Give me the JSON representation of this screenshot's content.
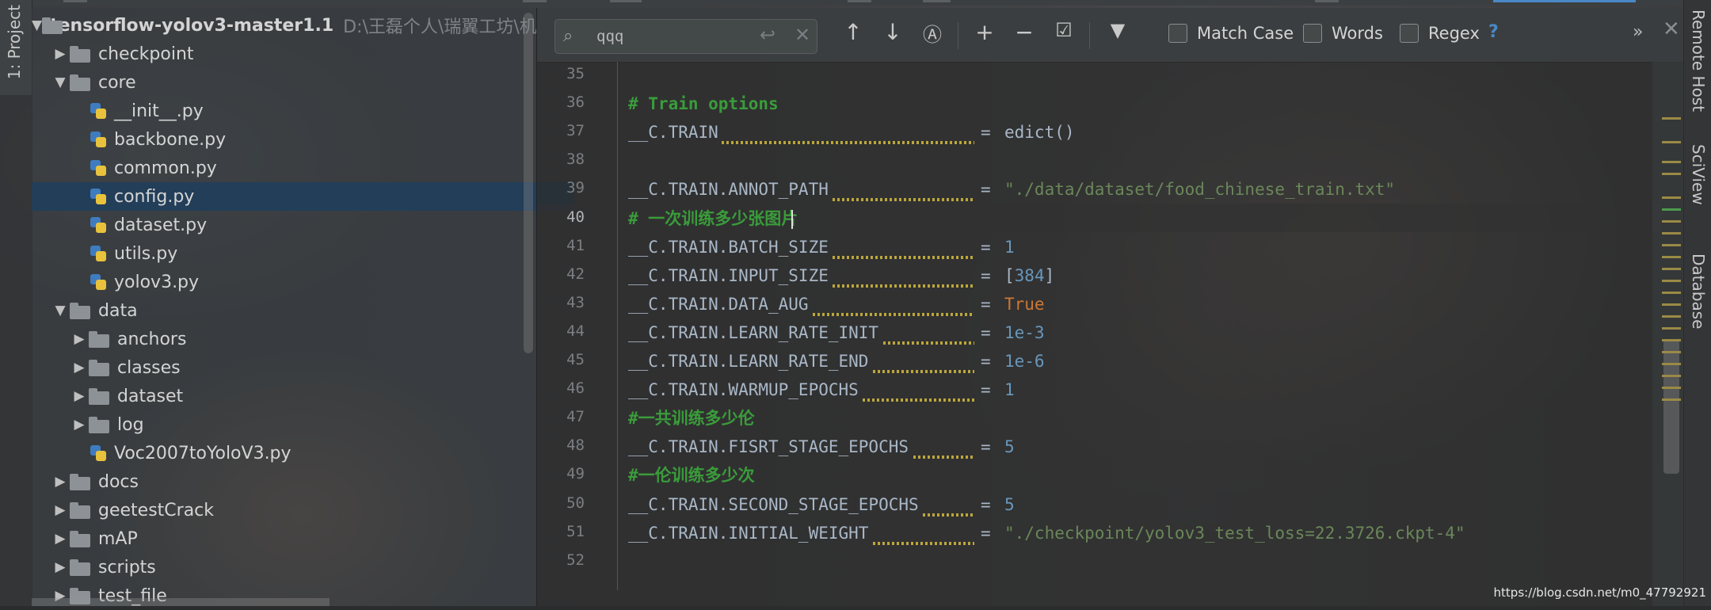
{
  "left_strip": {
    "project_tab": "1: Project"
  },
  "right_strip": {
    "remote_host": "Remote Host",
    "sciview": "SciView",
    "database": "Database"
  },
  "tree": {
    "root": {
      "name": "tensorflow-yolov3-master1.1",
      "path": "D:\\王磊个人\\瑞翼工坊\\机"
    },
    "rows": [
      {
        "name": "checkpoint",
        "type": "folder",
        "level": 1,
        "expanded": false
      },
      {
        "name": "core",
        "type": "folder",
        "level": 1,
        "expanded": true
      },
      {
        "name": "__init__.py",
        "type": "file",
        "level": 2
      },
      {
        "name": "backbone.py",
        "type": "file",
        "level": 2
      },
      {
        "name": "common.py",
        "type": "file",
        "level": 2
      },
      {
        "name": "config.py",
        "type": "file",
        "level": 2,
        "selected": true
      },
      {
        "name": "dataset.py",
        "type": "file",
        "level": 2
      },
      {
        "name": "utils.py",
        "type": "file",
        "level": 2
      },
      {
        "name": "yolov3.py",
        "type": "file",
        "level": 2
      },
      {
        "name": "data",
        "type": "folder",
        "level": 1,
        "expanded": true
      },
      {
        "name": "anchors",
        "type": "folder",
        "level": 2,
        "expanded": false
      },
      {
        "name": "classes",
        "type": "folder",
        "level": 2,
        "expanded": false
      },
      {
        "name": "dataset",
        "type": "folder",
        "level": 2,
        "expanded": false
      },
      {
        "name": "log",
        "type": "folder",
        "level": 2,
        "expanded": false
      },
      {
        "name": "Voc2007toYoloV3.py",
        "type": "file",
        "level": 2
      },
      {
        "name": "docs",
        "type": "folder",
        "level": 1,
        "expanded": false
      },
      {
        "name": "geetestCrack",
        "type": "folder",
        "level": 1,
        "expanded": false
      },
      {
        "name": "mAP",
        "type": "folder",
        "level": 1,
        "expanded": false
      },
      {
        "name": "scripts",
        "type": "folder",
        "level": 1,
        "expanded": false
      },
      {
        "name": "test_file",
        "type": "folder",
        "level": 1,
        "expanded": false
      }
    ]
  },
  "find_bar": {
    "query": "qqq",
    "match_case": "Match Case",
    "words": "Words",
    "regex": "Regex",
    "help": "?"
  },
  "code": {
    "current_line": 40,
    "lines": [
      {
        "n": "35",
        "text": ""
      },
      {
        "n": "36",
        "text": "# Train options"
      },
      {
        "n": "37",
        "lhs": "__C.TRAIN",
        "rhs": "edict()"
      },
      {
        "n": "38",
        "text": ""
      },
      {
        "n": "39",
        "lhs": "__C.TRAIN.ANNOT_PATH",
        "rhs": "\"./data/dataset/food_chinese_train.txt\""
      },
      {
        "n": "40",
        "text": "# 一次训练多少张图片"
      },
      {
        "n": "41",
        "lhs": "__C.TRAIN.BATCH_SIZE",
        "rhs": "1"
      },
      {
        "n": "42",
        "lhs": "__C.TRAIN.INPUT_SIZE",
        "rhs_open": "[",
        "rhs_num": "384",
        "rhs_close": "]"
      },
      {
        "n": "43",
        "lhs": "__C.TRAIN.DATA_AUG",
        "rhs": "True"
      },
      {
        "n": "44",
        "lhs": "__C.TRAIN.LEARN_RATE_INIT",
        "rhs": "1e-3"
      },
      {
        "n": "45",
        "lhs": "__C.TRAIN.LEARN_RATE_END",
        "rhs": "1e-6"
      },
      {
        "n": "46",
        "lhs": "__C.TRAIN.WARMUP_EPOCHS",
        "rhs": "1"
      },
      {
        "n": "47",
        "text": "#一共训练多少伦"
      },
      {
        "n": "48",
        "lhs": "__C.TRAIN.FISRT_STAGE_EPOCHS",
        "rhs": "5"
      },
      {
        "n": "49",
        "text": "#一伦训练多少次"
      },
      {
        "n": "50",
        "lhs": "__C.TRAIN.SECOND_STAGE_EPOCHS",
        "rhs": "5"
      },
      {
        "n": "51",
        "lhs": "__C.TRAIN.INITIAL_WEIGHT",
        "rhs": "\"./checkpoint/yolov3_test_loss=22.3726.ckpt-4\""
      },
      {
        "n": "52",
        "text": ""
      }
    ],
    "equals": "="
  },
  "watermark": "https://blog.csdn.net/m0_47792921",
  "colors": {
    "comment": "#3a9c3a",
    "string": "#6a8759",
    "number": "#6897bb",
    "keyword": "#cc7832",
    "selection": "#203e5c"
  }
}
